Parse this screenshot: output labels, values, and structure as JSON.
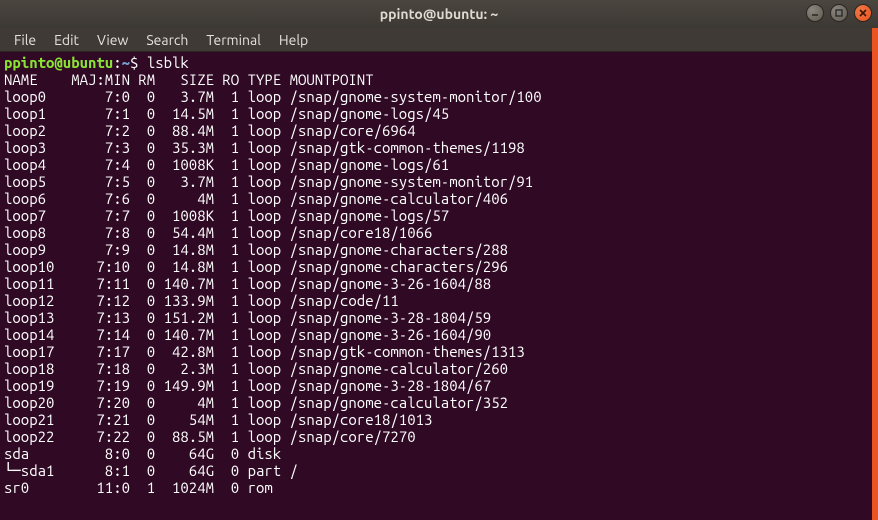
{
  "window": {
    "title": "ppinto@ubuntu: ~",
    "controls": {
      "minimize": "minimize-icon",
      "maximize": "maximize-icon",
      "close": "close-icon"
    }
  },
  "menubar": {
    "items": [
      "File",
      "Edit",
      "View",
      "Search",
      "Terminal",
      "Help"
    ]
  },
  "prompt": {
    "userhost": "ppinto@ubuntu",
    "sep": ":",
    "path": "~",
    "sigil": "$ ",
    "command": "lsblk"
  },
  "lsblk": {
    "headers": [
      "NAME",
      "MAJ:MIN",
      "RM",
      "SIZE",
      "RO",
      "TYPE",
      "MOUNTPOINT"
    ],
    "rows": [
      {
        "name": "loop0",
        "maj": "7:0",
        "rm": "0",
        "size": "3.7M",
        "ro": "1",
        "type": "loop",
        "mount": "/snap/gnome-system-monitor/100"
      },
      {
        "name": "loop1",
        "maj": "7:1",
        "rm": "0",
        "size": "14.5M",
        "ro": "1",
        "type": "loop",
        "mount": "/snap/gnome-logs/45"
      },
      {
        "name": "loop2",
        "maj": "7:2",
        "rm": "0",
        "size": "88.4M",
        "ro": "1",
        "type": "loop",
        "mount": "/snap/core/6964"
      },
      {
        "name": "loop3",
        "maj": "7:3",
        "rm": "0",
        "size": "35.3M",
        "ro": "1",
        "type": "loop",
        "mount": "/snap/gtk-common-themes/1198"
      },
      {
        "name": "loop4",
        "maj": "7:4",
        "rm": "0",
        "size": "1008K",
        "ro": "1",
        "type": "loop",
        "mount": "/snap/gnome-logs/61"
      },
      {
        "name": "loop5",
        "maj": "7:5",
        "rm": "0",
        "size": "3.7M",
        "ro": "1",
        "type": "loop",
        "mount": "/snap/gnome-system-monitor/91"
      },
      {
        "name": "loop6",
        "maj": "7:6",
        "rm": "0",
        "size": "4M",
        "ro": "1",
        "type": "loop",
        "mount": "/snap/gnome-calculator/406"
      },
      {
        "name": "loop7",
        "maj": "7:7",
        "rm": "0",
        "size": "1008K",
        "ro": "1",
        "type": "loop",
        "mount": "/snap/gnome-logs/57"
      },
      {
        "name": "loop8",
        "maj": "7:8",
        "rm": "0",
        "size": "54.4M",
        "ro": "1",
        "type": "loop",
        "mount": "/snap/core18/1066"
      },
      {
        "name": "loop9",
        "maj": "7:9",
        "rm": "0",
        "size": "14.8M",
        "ro": "1",
        "type": "loop",
        "mount": "/snap/gnome-characters/288"
      },
      {
        "name": "loop10",
        "maj": "7:10",
        "rm": "0",
        "size": "14.8M",
        "ro": "1",
        "type": "loop",
        "mount": "/snap/gnome-characters/296"
      },
      {
        "name": "loop11",
        "maj": "7:11",
        "rm": "0",
        "size": "140.7M",
        "ro": "1",
        "type": "loop",
        "mount": "/snap/gnome-3-26-1604/88"
      },
      {
        "name": "loop12",
        "maj": "7:12",
        "rm": "0",
        "size": "133.9M",
        "ro": "1",
        "type": "loop",
        "mount": "/snap/code/11"
      },
      {
        "name": "loop13",
        "maj": "7:13",
        "rm": "0",
        "size": "151.2M",
        "ro": "1",
        "type": "loop",
        "mount": "/snap/gnome-3-28-1804/59"
      },
      {
        "name": "loop14",
        "maj": "7:14",
        "rm": "0",
        "size": "140.7M",
        "ro": "1",
        "type": "loop",
        "mount": "/snap/gnome-3-26-1604/90"
      },
      {
        "name": "loop17",
        "maj": "7:17",
        "rm": "0",
        "size": "42.8M",
        "ro": "1",
        "type": "loop",
        "mount": "/snap/gtk-common-themes/1313"
      },
      {
        "name": "loop18",
        "maj": "7:18",
        "rm": "0",
        "size": "2.3M",
        "ro": "1",
        "type": "loop",
        "mount": "/snap/gnome-calculator/260"
      },
      {
        "name": "loop19",
        "maj": "7:19",
        "rm": "0",
        "size": "149.9M",
        "ro": "1",
        "type": "loop",
        "mount": "/snap/gnome-3-28-1804/67"
      },
      {
        "name": "loop20",
        "maj": "7:20",
        "rm": "0",
        "size": "4M",
        "ro": "1",
        "type": "loop",
        "mount": "/snap/gnome-calculator/352"
      },
      {
        "name": "loop21",
        "maj": "7:21",
        "rm": "0",
        "size": "54M",
        "ro": "1",
        "type": "loop",
        "mount": "/snap/core18/1013"
      },
      {
        "name": "loop22",
        "maj": "7:22",
        "rm": "0",
        "size": "88.5M",
        "ro": "1",
        "type": "loop",
        "mount": "/snap/core/7270"
      },
      {
        "name": "sda",
        "maj": "8:0",
        "rm": "0",
        "size": "64G",
        "ro": "0",
        "type": "disk",
        "mount": ""
      },
      {
        "name": "└─sda1",
        "maj": "8:1",
        "rm": "0",
        "size": "64G",
        "ro": "0",
        "type": "part",
        "mount": "/"
      },
      {
        "name": "sr0",
        "maj": "11:0",
        "rm": "1",
        "size": "1024M",
        "ro": "0",
        "type": "rom",
        "mount": ""
      }
    ]
  }
}
